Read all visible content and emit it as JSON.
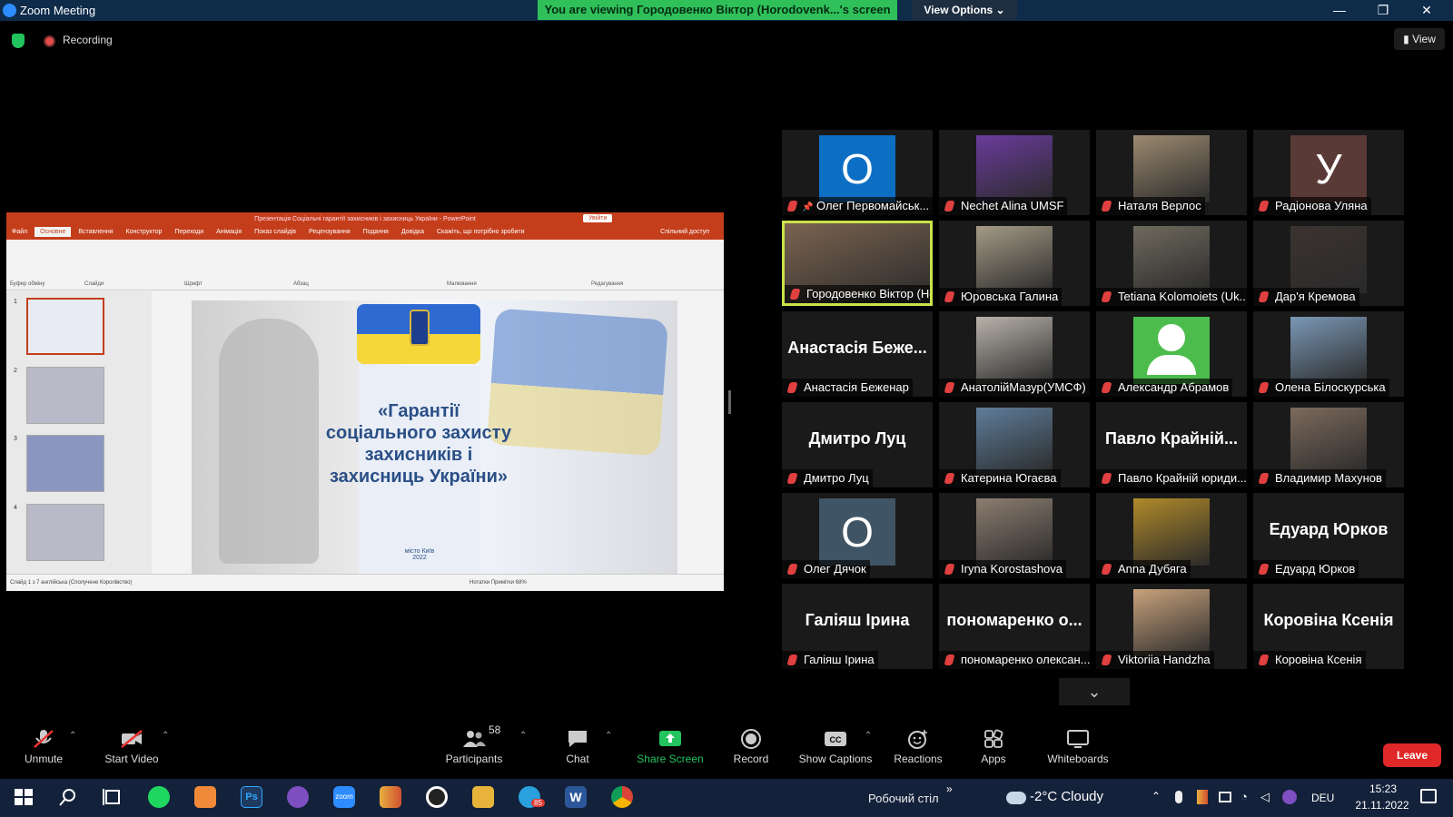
{
  "window": {
    "title": "Zoom Meeting",
    "minimize": "—",
    "maximize": "❐",
    "close": "✕"
  },
  "banner": {
    "viewing": "You are viewing Городовенко Віктор (Horodovenk...'s screen",
    "view_options": "View Options ⌄"
  },
  "status": {
    "recording": "Recording",
    "view": "▮ View"
  },
  "shared_screen": {
    "ppt_title": "Презентація Соціальні гарантії захисників і захисниць України  -  PowerPoint",
    "signin": "Увійти",
    "tabs": [
      "Файл",
      "Основне",
      "Вставлення",
      "Конструктор",
      "Переходи",
      "Анімація",
      "Показ слайдів",
      "Рецензування",
      "Подання",
      "Довідка",
      "Скажіть, що потрібно зробити",
      "Спільний доступ"
    ],
    "ribbon_groups": [
      "Буфер обміну",
      "Слайди",
      "Шрифт",
      "Абзац",
      "Малювання",
      "Редагування"
    ],
    "slide_title": "«Гарантії\nсоціального захисту\nзахисників і\nзахисниць України»",
    "slide_city": "місто Київ\n2022",
    "thumb_numbers": [
      "1",
      "2",
      "3",
      "4"
    ],
    "status_left": "Слайд 1 з 7     англійська (Сполучене Королівство)",
    "status_right": "Нотатки    Примітки          68%"
  },
  "participants_tiles": [
    {
      "caption": "Олег Первомайськ...",
      "letter": "О",
      "avatar_color": "#0d6fc4",
      "pinned": true
    },
    {
      "caption": "Nechet Alina UMSF",
      "photo_color": "#6a3b9c"
    },
    {
      "caption": "Наталя Верлос",
      "photo_color": "#9c8a70"
    },
    {
      "caption": "Радіонова Уляна",
      "letter": "У",
      "avatar_color": "#5a3a36"
    },
    {
      "caption": "Городовенко Віктор (Hor...",
      "photo_color": "#7a6350",
      "active": true
    },
    {
      "caption": "Юровська Галина",
      "photo_color": "#a49a86"
    },
    {
      "caption": "Tetiana Kolomoiets (Uk...",
      "photo_color": "#6f6a5e"
    },
    {
      "caption": "Дар'я Кремова",
      "photo_color": "#3b3330"
    },
    {
      "caption": "Анастасія Беженар",
      "bigname": "Анастасія Беже..."
    },
    {
      "caption": "АнатолійМазур(УМСФ)",
      "photo_color": "#b8b2aa"
    },
    {
      "caption": "Александр Абрамов",
      "avatar_color": "#4cbd4c",
      "generic": true
    },
    {
      "caption": "Олена Білоскурська",
      "photo_color": "#7b98b6"
    },
    {
      "caption": "Дмитро Луц",
      "bigname": "Дмитро Луц"
    },
    {
      "caption": "Катерина Югаєва",
      "photo_color": "#5f7d9a"
    },
    {
      "caption": "Павло Крайній юриди...",
      "bigname": "Павло Крайній..."
    },
    {
      "caption": "Владимир Махунов",
      "photo_color": "#7c6a5c"
    },
    {
      "caption": "Олег Дячок",
      "letter": "О",
      "avatar_color": "#3f5565"
    },
    {
      "caption": "Iryna Korostashova",
      "photo_color": "#8c7d70"
    },
    {
      "caption": "Anna Дубяга",
      "photo_color": "#b08a2a"
    },
    {
      "caption": "Едуард Юрков",
      "bigname": "Едуард Юрков"
    },
    {
      "caption": "Галіяш Ірина",
      "bigname": "Галіяш Ірина"
    },
    {
      "caption": "пономаренко олексан...",
      "bigname": "пономаренко о..."
    },
    {
      "caption": "Viktoriia Handzha",
      "photo_color": "#c8a27c"
    },
    {
      "caption": "Коровіна Ксенія",
      "bigname": "Коровіна Ксенія"
    }
  ],
  "gallery_more": "⌄",
  "toolbar": {
    "unmute": "Unmute",
    "start_video": "Start Video",
    "participants": "Participants",
    "participants_count": "58",
    "chat": "Chat",
    "share_screen": "Share Screen",
    "record": "Record",
    "show_captions": "Show Captions",
    "reactions": "Reactions",
    "apps": "Apps",
    "whiteboards": "Whiteboards",
    "leave": "Leave"
  },
  "taskbar": {
    "desktop": "Робочий стіл",
    "weather": "-2°C  Cloudy",
    "lang": "DEU",
    "time": "15:23",
    "date": "21.11.2022",
    "telegram_badge": "85"
  },
  "colors": {
    "banner": "#2fc05a",
    "leave": "#e02828",
    "share": "#23c45e",
    "active_speaker": "#c9e34a",
    "ppt": "#c43e1c"
  }
}
